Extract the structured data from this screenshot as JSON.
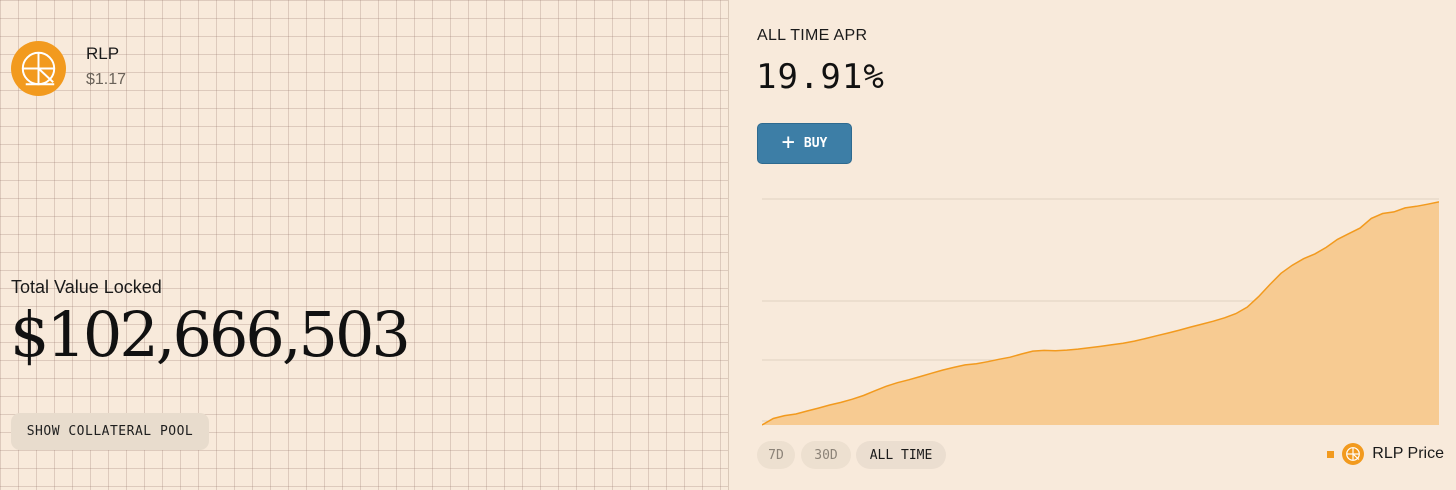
{
  "token": {
    "name": "RLP",
    "price": "$1.17",
    "icon": "rlp-logo-icon",
    "brand_color": "#f29a1e"
  },
  "tvl": {
    "label": "Total Value Locked",
    "value": "$102,666,503"
  },
  "buttons": {
    "collateral_pool": "SHOW COLLATERAL POOL",
    "buy": "BUY",
    "buy_color": "#3d7ea6"
  },
  "apr": {
    "label": "ALL TIME APR",
    "value": "19.91%"
  },
  "ranges": [
    {
      "label": "7D",
      "active": false
    },
    {
      "label": "30D",
      "active": false
    },
    {
      "label": "ALL TIME",
      "active": true
    }
  ],
  "chart_data": {
    "type": "area",
    "series": [
      {
        "name": "RLP Price",
        "color": "#f29a1e",
        "values": [
          0.0,
          0.04,
          0.058,
          0.068,
          0.087,
          0.105,
          0.124,
          0.14,
          0.16,
          0.183,
          0.212,
          0.24,
          0.262,
          0.28,
          0.3,
          0.32,
          0.34,
          0.357,
          0.372,
          0.38,
          0.392,
          0.407,
          0.42,
          0.44,
          0.458,
          0.462,
          0.46,
          0.464,
          0.47,
          0.478,
          0.487,
          0.497,
          0.507,
          0.52,
          0.536,
          0.553,
          0.57,
          0.588,
          0.607,
          0.625,
          0.643,
          0.664,
          0.69,
          0.73,
          0.795,
          0.87,
          0.94,
          0.99,
          1.03,
          1.06,
          1.1,
          1.15,
          1.185,
          1.22,
          1.28,
          1.31,
          1.32,
          1.345,
          1.355,
          1.368,
          1.382
        ]
      }
    ],
    "ylim": [
      0,
      1.4
    ],
    "grid": "horizontal",
    "legend": "bottom-right"
  }
}
